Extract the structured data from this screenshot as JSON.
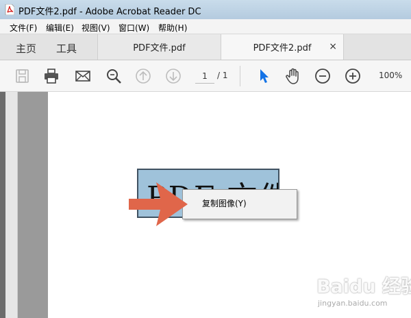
{
  "window": {
    "title": "PDF文件2.pdf - Adobe Acrobat Reader DC"
  },
  "menubar": {
    "items": [
      "文件(F)",
      "编辑(E)",
      "视图(V)",
      "窗口(W)",
      "帮助(H)"
    ]
  },
  "tabs": {
    "home": "主页",
    "tools": "工具",
    "documents": [
      {
        "label": "PDF文件.pdf"
      },
      {
        "label": "PDF文件2.pdf",
        "close": "×"
      }
    ]
  },
  "toolbar": {
    "icons": [
      "save-icon",
      "print-icon",
      "email-icon",
      "find-zoom-icon",
      "prev-page-icon",
      "next-page-icon",
      "select-tool-icon",
      "hand-tool-icon",
      "zoom-out-icon",
      "zoom-in-icon"
    ],
    "page_current": "1",
    "page_total": "/ 1",
    "zoom": "100%",
    "accent_color": "#1473e6"
  },
  "document": {
    "image_text": "PDF 文件"
  },
  "context_menu": {
    "items": [
      {
        "label": "复制图像(Y)"
      }
    ]
  },
  "annotation": {
    "arrow_color": "#e0664a"
  },
  "watermark": {
    "logo": "Baidu 经验",
    "url": "jingyan.baidu.com"
  }
}
